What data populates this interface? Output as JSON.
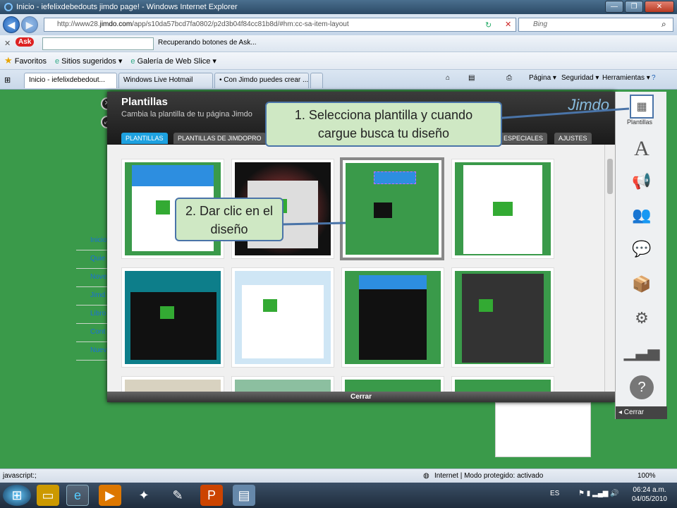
{
  "window": {
    "title": "Inicio - iefelixdebedouts jimdo page! - Windows Internet Explorer"
  },
  "address": {
    "url_prefix": "http://www28.",
    "url_domain": "jimdo.com",
    "url_rest": "/app/s10da57bcd7fa0802/p2d3b04f84cc81b8d/#hm:cc-sa-item-layout",
    "search_placeholder": "Bing"
  },
  "askbar": {
    "status": "Recuperando botones de Ask..."
  },
  "favorites": {
    "favoritos": "Favoritos",
    "sitios": "Sitios sugeridos ▾",
    "galeria": "Galería de Web Slice ▾"
  },
  "tabs": [
    {
      "label": "Inicio - iefelixdebedout..."
    },
    {
      "label": "Windows Live Hotmail"
    },
    {
      "label": "• Con Jimdo puedes crear ..."
    }
  ],
  "commandbar": {
    "pagina": "Página ▾",
    "seguridad": "Seguridad ▾",
    "herramientas": "Herramientas ▾"
  },
  "leftmenu": [
    "Inicio",
    "Quie",
    "Nove",
    "Jimd",
    "Libro",
    "Cont",
    "Nuev"
  ],
  "dialog": {
    "title": "Plantillas",
    "subtitle": "Cambia la plantilla de tu página Jimdo",
    "logo": "Jimdo",
    "tabs": [
      "PLANTILLAS",
      "PLANTILLAS DE JIMDOPRO",
      "ESPECIALES",
      "AJUSTES"
    ],
    "close_label": "Cerrar"
  },
  "rightpanel": {
    "plantillas": "Plantillas",
    "cerrar": "◂ Cerrar"
  },
  "callouts": {
    "step1": "1. Selecciona plantilla y cuando cargue busca tu diseño",
    "step2": "2. Dar clic en el diseño"
  },
  "status": {
    "left": "javascript:;",
    "zone": "Internet | Modo protegido: activado",
    "zoom": "100%"
  },
  "taskbar": {
    "lang": "ES",
    "time": "06:24 a.m.",
    "date": "04/05/2010"
  }
}
